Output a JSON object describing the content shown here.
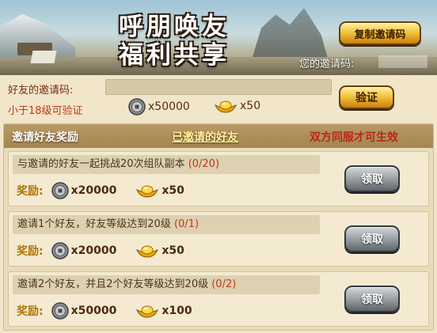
{
  "banner": {
    "title_line1": "呼朋唤友",
    "title_line2": "福利共享",
    "copy_button_label": "复制邀请码",
    "my_code_label": "您的邀请码:",
    "my_code_value": ""
  },
  "verify": {
    "friend_code_label": "好友的邀请码:",
    "friend_code_value": "",
    "level_note": "小于18级可验证",
    "coin_cost": "x50000",
    "ingot_cost": "x50",
    "verify_button_label": "验证"
  },
  "rewards": {
    "tab_rewards": "邀请好友奖励",
    "tab_invited": "已邀请的好友",
    "server_note": "双方同服才可生效",
    "reward_label": "奖励:",
    "claim_label": "领取",
    "tasks": [
      {
        "desc": "与邀请的好友一起挑战20次组队副本",
        "progress": "(0/20)",
        "coins": "x20000",
        "ingots": "x50"
      },
      {
        "desc": "邀请1个好友，好友等级达到20级",
        "progress": "(0/1)",
        "coins": "x20000",
        "ingots": "x50"
      },
      {
        "desc": "邀请2个好友，并且2个好友等级达到20级",
        "progress": "(0/2)",
        "coins": "x50000",
        "ingots": "x100"
      }
    ]
  },
  "colors": {
    "accent_red": "#c2361a",
    "gold_button": "#f2c440",
    "silver_button": "#9aa0a4",
    "panel_header": "#b99a66"
  },
  "icons": [
    "coin-icon",
    "gold-ingot-icon"
  ]
}
